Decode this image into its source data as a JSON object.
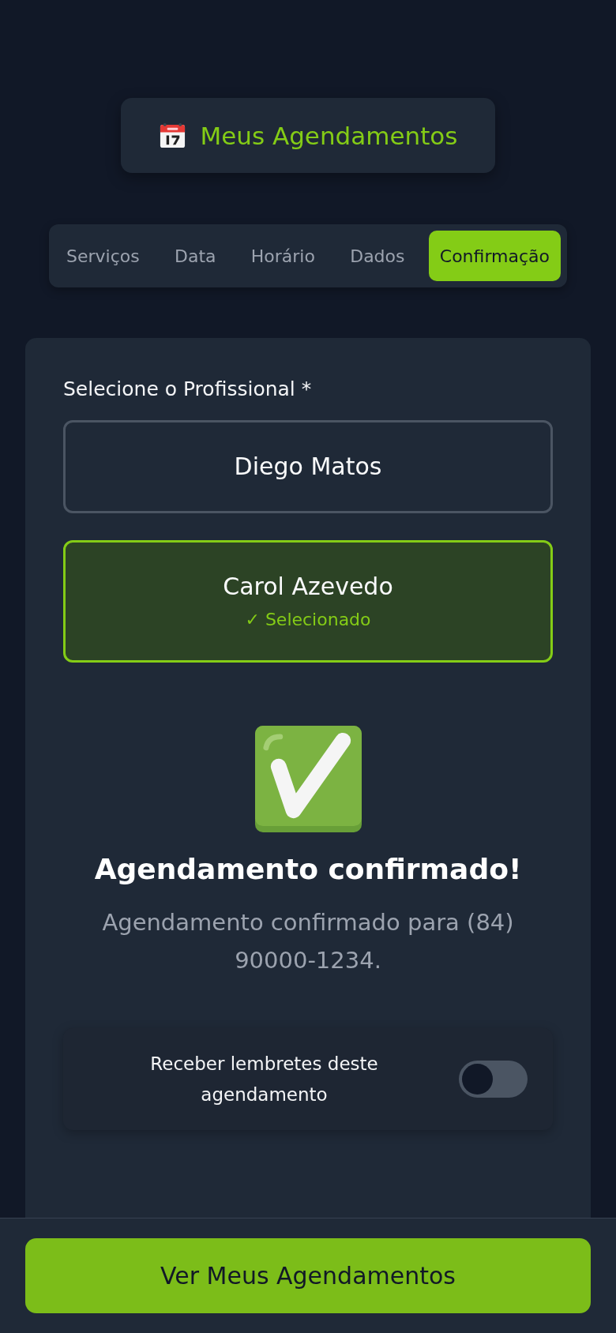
{
  "header": {
    "title": "Meus Agendamentos"
  },
  "tabs": [
    {
      "label": "Serviços",
      "selected": false
    },
    {
      "label": "Data",
      "selected": false
    },
    {
      "label": "Horário",
      "selected": false
    },
    {
      "label": "Dados",
      "selected": false
    },
    {
      "label": "Confirmação",
      "selected": true
    }
  ],
  "professional_picker": {
    "label": "Selecione o Profissional *",
    "selected_note": "✓ Selecionado",
    "options": [
      {
        "name": "Diego Matos",
        "selected": false
      },
      {
        "name": "Carol Azevedo",
        "selected": true
      }
    ]
  },
  "confirmation": {
    "title": "Agendamento confirmado!",
    "message": "Agendamento confirmado para (84) 90000-1234."
  },
  "reminder": {
    "label": "Receber lembretes deste agendamento",
    "on": false
  },
  "footer_button": {
    "label": "Ver Meus Agendamentos"
  }
}
